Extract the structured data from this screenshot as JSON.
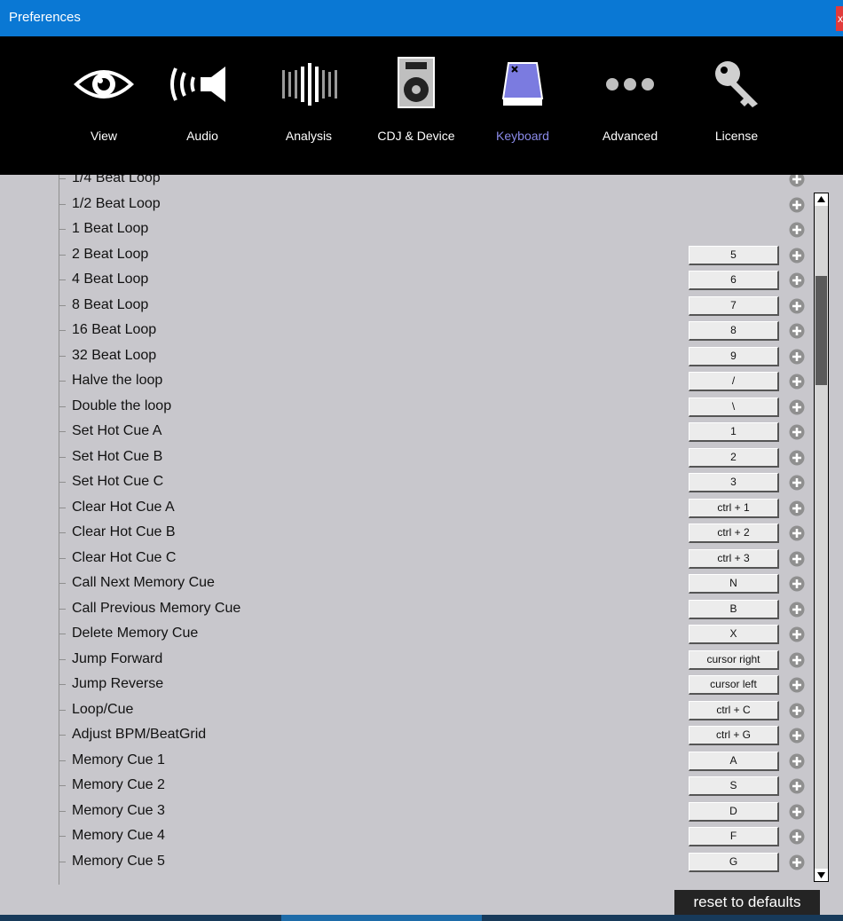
{
  "window": {
    "title": "Preferences",
    "close_glyph": "x"
  },
  "toolbar": {
    "items": [
      {
        "label": "View",
        "icon": "eye-icon"
      },
      {
        "label": "Audio",
        "icon": "speaker-icon"
      },
      {
        "label": "Analysis",
        "icon": "waveform-icon"
      },
      {
        "label": "CDJ & Device",
        "icon": "cdj-device-icon"
      },
      {
        "label": "Keyboard",
        "icon": "keyboard-key-icon",
        "active": true
      },
      {
        "label": "Advanced",
        "icon": "more-dots-icon"
      },
      {
        "label": "License",
        "icon": "key-icon"
      }
    ],
    "active_color": "#8a8ae8"
  },
  "shortcuts": {
    "rows": [
      {
        "label": "1/4 Beat Loop",
        "key": ""
      },
      {
        "label": "1/2 Beat Loop",
        "key": ""
      },
      {
        "label": "1 Beat Loop",
        "key": ""
      },
      {
        "label": "2 Beat Loop",
        "key": "5"
      },
      {
        "label": "4 Beat Loop",
        "key": "6"
      },
      {
        "label": "8 Beat Loop",
        "key": "7"
      },
      {
        "label": "16 Beat Loop",
        "key": "8"
      },
      {
        "label": "32 Beat Loop",
        "key": "9"
      },
      {
        "label": "Halve the loop",
        "key": "/"
      },
      {
        "label": "Double the loop",
        "key": "\\"
      },
      {
        "label": "Set Hot Cue A",
        "key": "1"
      },
      {
        "label": "Set Hot Cue B",
        "key": "2"
      },
      {
        "label": "Set Hot Cue C",
        "key": "3"
      },
      {
        "label": "Clear Hot Cue A",
        "key": "ctrl + 1"
      },
      {
        "label": "Clear Hot Cue B",
        "key": "ctrl + 2"
      },
      {
        "label": "Clear Hot Cue C",
        "key": "ctrl + 3"
      },
      {
        "label": "Call Next Memory Cue",
        "key": "N"
      },
      {
        "label": "Call Previous Memory Cue",
        "key": "B"
      },
      {
        "label": "Delete Memory Cue",
        "key": "X"
      },
      {
        "label": "Jump Forward",
        "key": "cursor right"
      },
      {
        "label": "Jump Reverse",
        "key": "cursor left"
      },
      {
        "label": "Loop/Cue",
        "key": "ctrl + C"
      },
      {
        "label": "Adjust BPM/BeatGrid",
        "key": "ctrl + G"
      },
      {
        "label": "Memory Cue 1",
        "key": "A"
      },
      {
        "label": "Memory Cue 2",
        "key": "S"
      },
      {
        "label": "Memory Cue 3",
        "key": "D"
      },
      {
        "label": "Memory Cue 4",
        "key": "F"
      },
      {
        "label": "Memory Cue 5",
        "key": "G"
      }
    ]
  },
  "footer": {
    "reset_label": "reset to defaults"
  }
}
